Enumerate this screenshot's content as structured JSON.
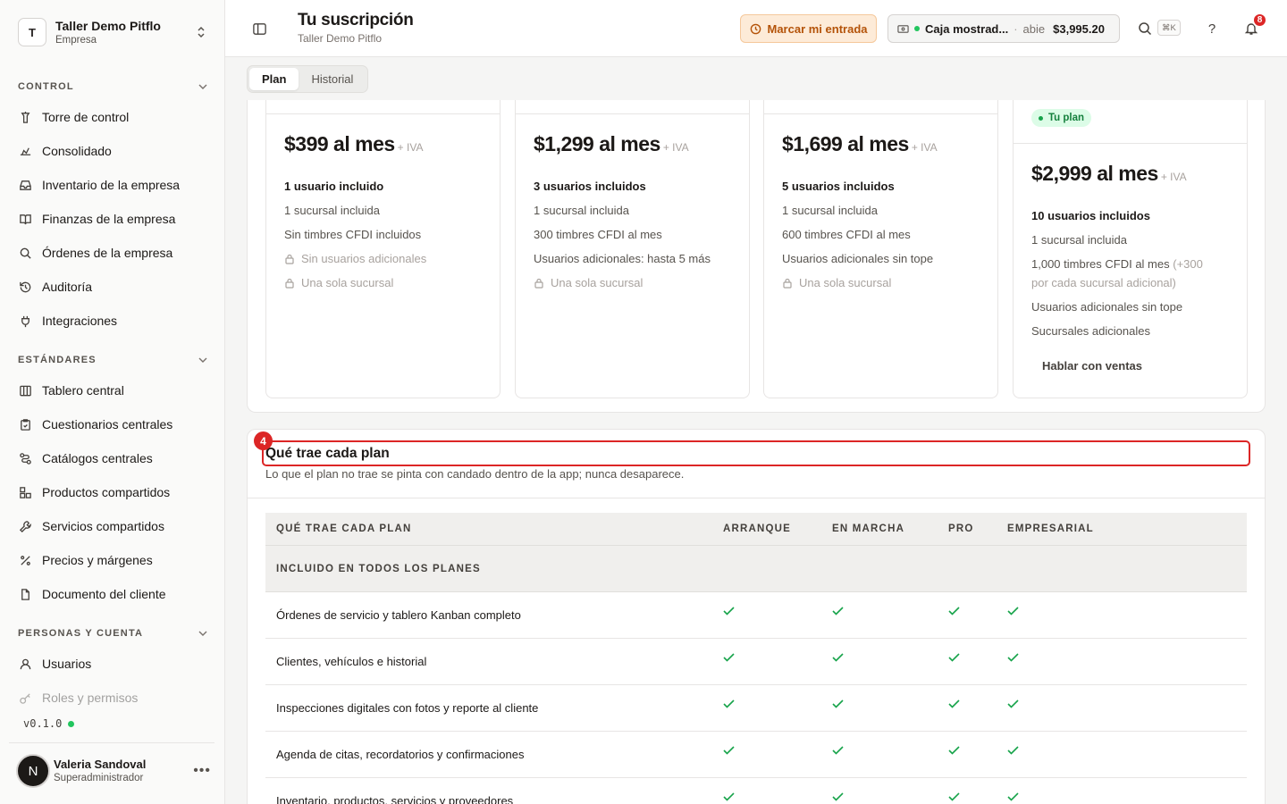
{
  "org": {
    "initial": "T",
    "name": "Taller Demo Pitflo",
    "type": "Empresa"
  },
  "sidebar": {
    "groups": [
      {
        "label": "CONTROL",
        "items": [
          {
            "label": "Torre de control",
            "icon": "tower-icon"
          },
          {
            "label": "Consolidado",
            "icon": "consolidated-icon"
          },
          {
            "label": "Inventario de la empresa",
            "icon": "inbox-icon"
          },
          {
            "label": "Finanzas de la empresa",
            "icon": "book-icon"
          },
          {
            "label": "Órdenes de la empresa",
            "icon": "search-icon"
          },
          {
            "label": "Auditoría",
            "icon": "history-icon"
          },
          {
            "label": "Integraciones",
            "icon": "plug-icon"
          }
        ]
      },
      {
        "label": "ESTÁNDARES",
        "items": [
          {
            "label": "Tablero central",
            "icon": "columns-icon"
          },
          {
            "label": "Cuestionarios centrales",
            "icon": "clipboard-icon"
          },
          {
            "label": "Catálogos centrales",
            "icon": "route-icon"
          },
          {
            "label": "Productos compartidos",
            "icon": "boxes-icon"
          },
          {
            "label": "Servicios compartidos",
            "icon": "wrench-icon"
          },
          {
            "label": "Precios y márgenes",
            "icon": "percent-icon"
          },
          {
            "label": "Documento del cliente",
            "icon": "file-icon"
          }
        ]
      },
      {
        "label": "PERSONAS Y CUENTA",
        "items": [
          {
            "label": "Usuarios",
            "icon": "user-icon"
          },
          {
            "label": "Roles y permisos",
            "icon": "key-icon"
          }
        ]
      }
    ],
    "version": "v0.1.0"
  },
  "user": {
    "initial": "N",
    "name": "Valeria Sandoval",
    "role": "Superadministrador"
  },
  "header": {
    "title": "Tu suscripción",
    "subtitle": "Taller Demo Pitflo",
    "clock_label": "Marcar mi entrada",
    "register": {
      "name": "Caja mostrad...",
      "separator": "·",
      "status": "abie",
      "amount": "$3,995.20"
    },
    "shortcut": "⌘K",
    "notifications": "8"
  },
  "tabs": [
    "Plan",
    "Historial"
  ],
  "plans": [
    {
      "price": "$399 al mes",
      "tax": "+ IVA",
      "headline": "1 usuario incluido",
      "features": [
        "1 sucursal incluida",
        "Sin timbres CFDI incluidos"
      ],
      "locked": [
        "Sin usuarios adicionales",
        "Una sola sucursal"
      ]
    },
    {
      "price": "$1,299 al mes",
      "tax": "+ IVA",
      "headline": "3 usuarios incluidos",
      "features": [
        "1 sucursal incluida",
        "300 timbres CFDI al mes",
        "Usuarios adicionales: hasta 5 más"
      ],
      "locked": [
        "Una sola sucursal"
      ]
    },
    {
      "price": "$1,699 al mes",
      "tax": "+ IVA",
      "headline": "5 usuarios incluidos",
      "features": [
        "1 sucursal incluida",
        "600 timbres CFDI al mes",
        "Usuarios adicionales sin tope"
      ],
      "locked": [
        "Una sola sucursal"
      ]
    },
    {
      "badge": "Tu plan",
      "price": "$2,999 al mes",
      "tax": "+ IVA",
      "headline": "10 usuarios incluidos",
      "features": [
        "1 sucursal incluida"
      ],
      "cfdi_main": "1,000 timbres CFDI al mes",
      "cfdi_note_a": "(+300",
      "cfdi_note_b": "por cada sucursal adicional)",
      "extra": [
        "Usuarios adicionales sin tope",
        "Sucursales adicionales"
      ],
      "cta": "Hablar con ventas"
    }
  ],
  "compare": {
    "step": "4",
    "title": "Qué trae cada plan",
    "description": "Lo que el plan no trae se pinta con candado dentro de la app; nunca desaparece.",
    "columns": [
      "QUÉ TRAE CADA PLAN",
      "ARRANQUE",
      "EN MARCHA",
      "PRO",
      "EMPRESARIAL"
    ],
    "group": "INCLUIDO EN TODOS LOS PLANES",
    "rows": [
      "Órdenes de servicio y tablero Kanban completo",
      "Clientes, vehículos e historial",
      "Inspecciones digitales con fotos y reporte al cliente",
      "Agenda de citas, recordatorios y confirmaciones",
      "Inventario, productos, servicios y proveedores"
    ]
  }
}
